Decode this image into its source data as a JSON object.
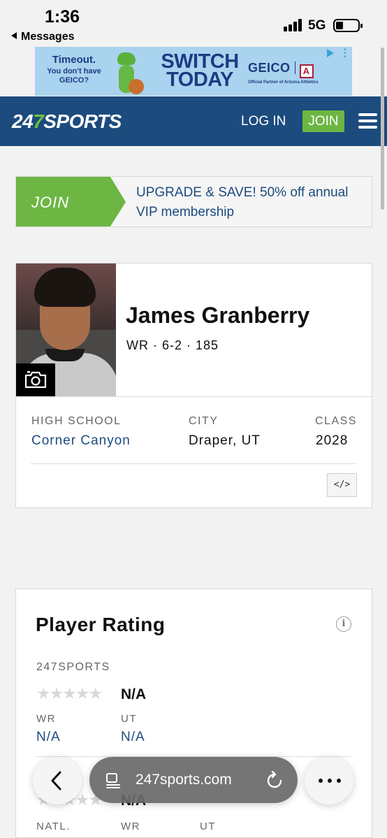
{
  "status_bar": {
    "time": "1:36",
    "back_app": "Messages",
    "network": "5G"
  },
  "ad": {
    "headline": "Timeout.",
    "subline": "You don't have GEICO?",
    "main": "SWITCH TODAY",
    "brand": "GEICO",
    "partner_logo": "A",
    "partner": "Official Partner of Arizona Athletics",
    "icons": [
      "ad-choices-icon",
      "more-vertical-icon"
    ]
  },
  "header": {
    "logo_prefix": "24",
    "logo_seven": "7",
    "logo_suffix": "SPORTS",
    "login": "LOG IN",
    "join": "JOIN",
    "menu_icon": "hamburger-menu-icon"
  },
  "upgrade": {
    "join": "JOIN",
    "text": "UPGRADE & SAVE! 50% off annual VIP membership"
  },
  "player": {
    "name": "James Granberry",
    "meta": "WR · 6-2 · 185",
    "high_school_label": "HIGH SCHOOL",
    "high_school": "Corner Canyon",
    "city_label": "CITY",
    "city": "Draper, UT",
    "class_label": "CLASS",
    "class": "2028",
    "embed": "</>",
    "camera_icon": "camera-icon"
  },
  "rating": {
    "title": "Player Rating",
    "info": "i",
    "source": "247SPORTS",
    "stars": "☆☆☆☆☆",
    "value": "N/A",
    "ranks": [
      {
        "label": "WR",
        "value": "N/A"
      },
      {
        "label": "UT",
        "value": "N/A"
      }
    ],
    "composite_value": "N/A",
    "composite_ranks": [
      {
        "label": "NATL."
      },
      {
        "label": "WR"
      },
      {
        "label": "UT"
      }
    ]
  },
  "toolbar": {
    "url": "247sports.com",
    "back_icon": "chevron-left-icon",
    "tabs_icon": "tabs-icon",
    "reload_icon": "reload-icon",
    "more_icon": "more-horizontal-icon"
  },
  "colors": {
    "brand_blue": "#1c4b7e",
    "brand_green": "#6db643",
    "ad_background": "#a9d3ee"
  }
}
